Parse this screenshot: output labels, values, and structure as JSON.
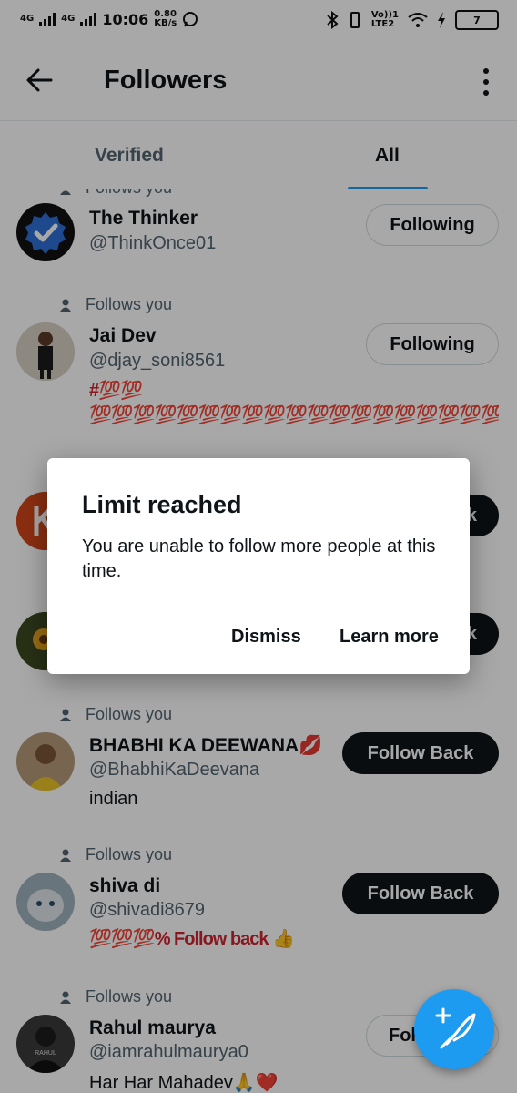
{
  "status_bar": {
    "signal_1": "4G",
    "signal_2": "4G",
    "time": "10:06",
    "net_speed_value": "0.80",
    "net_speed_unit": "KB/s",
    "lte_top": "Vo))1",
    "lte_bottom": "LTE2",
    "battery": "7"
  },
  "header": {
    "title": "Followers"
  },
  "tabs": [
    {
      "label": "Verified",
      "selected": false
    },
    {
      "label": "All",
      "selected": true
    }
  ],
  "follows_you_label": "Follows you",
  "followers": [
    {
      "name": "The Thinker",
      "handle": "@ThinkOnce01",
      "button": "Following",
      "follows_you": true,
      "bio": ""
    },
    {
      "name": "Jai Dev",
      "handle": "@djay_soni8561",
      "button": "Following",
      "follows_you": true,
      "bio": "#💯💯 💯💯💯💯💯💯💯💯💯💯💯💯💯💯💯💯💯💯💯💯💯💯💯💯💯💯💯💯💯💯💯💯% follow ..."
    },
    {
      "name": "",
      "handle": "",
      "button": "k",
      "follows_you": false,
      "bio": ""
    },
    {
      "name": "",
      "handle": "",
      "button": "k",
      "follows_you": false,
      "bio": ""
    },
    {
      "name": "BHABHI KA DEEWANA💋",
      "handle": "@BhabhiKaDeevana",
      "button": "Follow Back",
      "follows_you": true,
      "bio": "indian"
    },
    {
      "name": "shiva di",
      "handle": "@shivadi8679",
      "button": "Follow Back",
      "follows_you": true,
      "bio": "💯💯💯% Follow back 👍"
    },
    {
      "name": "Rahul maurya",
      "handle": "@iamrahulmaurya0",
      "button": "Fol",
      "follows_you": true,
      "bio": "Har Har Mahadev🙏❤️"
    }
  ],
  "avatar_labels": {
    "rahul": "RAHUL"
  },
  "dialog": {
    "title": "Limit reached",
    "message": "You are unable to follow more people at this time.",
    "dismiss": "Dismiss",
    "learn_more": "Learn more"
  },
  "colors": {
    "accent": "#1d9bf0",
    "text": "#0f1419",
    "secondary": "#536471"
  },
  "icons": {
    "back": "arrow-left-icon",
    "more": "more-vertical-icon",
    "fab": "compose-feather-icon",
    "person": "person-icon",
    "verified": "verified-badge-icon"
  }
}
